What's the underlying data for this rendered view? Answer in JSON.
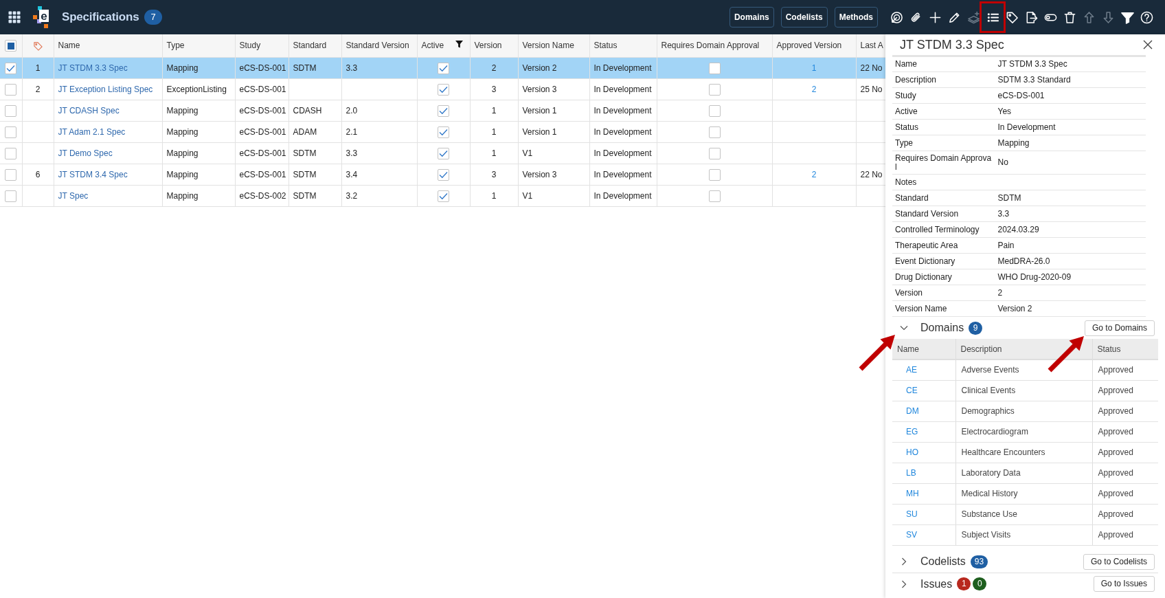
{
  "top_bar": {
    "logo_letter": "e",
    "title": "Specifications",
    "count": "7",
    "buttons": [
      "Domains",
      "Codelists",
      "Methods"
    ],
    "tools": [
      {
        "disabled": false,
        "highlighted": false
      },
      {
        "disabled": false,
        "highlighted": false
      },
      {
        "disabled": false,
        "highlighted": false
      },
      {
        "disabled": false,
        "highlighted": false
      },
      {
        "disabled": true,
        "highlighted": false
      },
      {
        "disabled": false,
        "highlighted": true
      },
      {
        "disabled": false,
        "highlighted": false
      },
      {
        "disabled": false,
        "highlighted": false
      },
      {
        "disabled": false,
        "highlighted": false
      },
      {
        "disabled": false,
        "highlighted": false
      },
      {
        "disabled": true,
        "highlighted": false
      },
      {
        "disabled": true,
        "highlighted": false
      },
      {
        "disabled": false,
        "highlighted": false
      },
      {
        "disabled": false,
        "highlighted": false
      }
    ]
  },
  "table": {
    "select_all_partial": true,
    "columns": [
      {
        "label": "Name",
        "filtered": false
      },
      {
        "label": "Type",
        "filtered": false
      },
      {
        "label": "Study",
        "filtered": false
      },
      {
        "label": "Standard",
        "filtered": false
      },
      {
        "label": "Standard Version",
        "filtered": false
      },
      {
        "label": "Active",
        "filtered": true
      },
      {
        "label": "Version",
        "filtered": false
      },
      {
        "label": "Version Name",
        "filtered": false
      },
      {
        "label": "Status",
        "filtered": false
      },
      {
        "label": "Requires Domain Approval",
        "filtered": false
      },
      {
        "label": "Approved Version",
        "filtered": false
      },
      {
        "label": "Last A",
        "filtered": false
      }
    ],
    "rows": [
      {
        "selected": true,
        "number": "1",
        "name": "JT STDM 3.3 Spec",
        "type": "Mapping",
        "study": "eCS-DS-001",
        "standard": "SDTM",
        "standard_version": "3.3",
        "active": true,
        "version": "2",
        "version_name": "Version 2",
        "status": "In Development",
        "requires_domain_approval": false,
        "approved_version": "1",
        "column_14": "22 No"
      },
      {
        "selected": false,
        "number": "2",
        "name": "JT Exception Listing Spec",
        "type": "ExceptionListing",
        "study": "eCS-DS-001",
        "active": true,
        "version": "3",
        "version_name": "Version 3",
        "status": "In Development",
        "requires_domain_approval": false,
        "approved_version": "2",
        "column_14": "25 No"
      },
      {
        "selected": false,
        "name": "JT CDASH Spec",
        "type": "Mapping",
        "study": "eCS-DS-001",
        "standard": "CDASH",
        "standard_version": "2.0",
        "active": true,
        "version": "1",
        "version_name": "Version 1",
        "status": "In Development",
        "requires_domain_approval": false
      },
      {
        "selected": false,
        "name": "JT Adam 2.1 Spec",
        "type": "Mapping",
        "study": "eCS-DS-001",
        "standard": "ADAM",
        "standard_version": "2.1",
        "active": true,
        "version": "1",
        "version_name": "Version 1",
        "status": "In Development",
        "requires_domain_approval": false
      },
      {
        "selected": false,
        "name": "JT Demo Spec",
        "type": "Mapping",
        "study": "eCS-DS-001",
        "standard": "SDTM",
        "standard_version": "3.3",
        "active": true,
        "version": "1",
        "version_name": "V1",
        "status": "In Development",
        "requires_domain_approval": false
      },
      {
        "selected": false,
        "number": "6",
        "name": "JT STDM 3.4 Spec",
        "type": "Mapping",
        "study": "eCS-DS-001",
        "standard": "SDTM",
        "standard_version": "3.4",
        "active": true,
        "version": "3",
        "version_name": "Version 3",
        "status": "In Development",
        "requires_domain_approval": false,
        "approved_version": "2",
        "column_14": "22 No"
      },
      {
        "selected": false,
        "name": "JT Spec",
        "type": "Mapping",
        "study": "eCS-DS-002",
        "standard": "SDTM",
        "standard_version": "3.2",
        "active": true,
        "version": "1",
        "version_name": "V1",
        "status": "In Development",
        "requires_domain_approval": false
      }
    ]
  },
  "detail_panel": {
    "title": "JT STDM 3.3 Spec",
    "fields": [
      {
        "label": "Name",
        "value": "JT STDM 3.3 Spec"
      },
      {
        "label": "Description",
        "value": "SDTM 3.3 Standard"
      },
      {
        "label": "Study",
        "value": "eCS-DS-001"
      },
      {
        "label": "Active",
        "value": "Yes"
      },
      {
        "label": "Status",
        "value": "In Development"
      },
      {
        "label": "Type",
        "value": "Mapping"
      },
      {
        "label": "Requires Domain Approval",
        "value": "No"
      },
      {
        "label": "Notes"
      },
      {
        "label": "Standard",
        "value": "SDTM"
      },
      {
        "label": "Standard Version",
        "value": "3.3"
      },
      {
        "label": "Controlled Terminology",
        "value": "2024.03.29"
      },
      {
        "label": "Therapeutic Area",
        "value": "Pain"
      },
      {
        "label": "Event Dictionary",
        "value": "MedDRA-26.0"
      },
      {
        "label": "Drug Dictionary",
        "value": "WHO Drug-2020-09"
      },
      {
        "label": "Version",
        "value": "2"
      },
      {
        "label": "Version Name",
        "value": "Version 2"
      }
    ],
    "sections": [
      {
        "title": "Domains",
        "expanded": true,
        "badges": [
          {
            "text": "9",
            "color": "#1f5fa3"
          }
        ],
        "button": "Go to Domains",
        "table": {
          "columns": [
            "Name",
            "Description",
            "Status"
          ],
          "rows": [
            {
              "name": "AE",
              "description": "Adverse Events",
              "status": "Approved"
            },
            {
              "name": "CE",
              "description": "Clinical Events",
              "status": "Approved"
            },
            {
              "name": "DM",
              "description": "Demographics",
              "status": "Approved"
            },
            {
              "name": "EG",
              "description": "Electrocardiogram",
              "status": "Approved"
            },
            {
              "name": "HO",
              "description": "Healthcare Encounters",
              "status": "Approved"
            },
            {
              "name": "LB",
              "description": "Laboratory Data",
              "status": "Approved"
            },
            {
              "name": "MH",
              "description": "Medical History",
              "status": "Approved"
            },
            {
              "name": "SU",
              "description": "Substance Use",
              "status": "Approved"
            },
            {
              "name": "SV",
              "description": "Subject Visits",
              "status": "Approved"
            }
          ]
        }
      },
      {
        "title": "Codelists",
        "expanded": false,
        "badges": [
          {
            "text": "93",
            "color": "#1f5fa3"
          }
        ],
        "button": "Go to Codelists"
      },
      {
        "title": "Issues",
        "expanded": false,
        "badges": [
          {
            "text": "1",
            "color": "#b8281e"
          },
          {
            "text": "0",
            "color": "#1e5e1e"
          }
        ],
        "button": "Go to Issues"
      }
    ]
  }
}
